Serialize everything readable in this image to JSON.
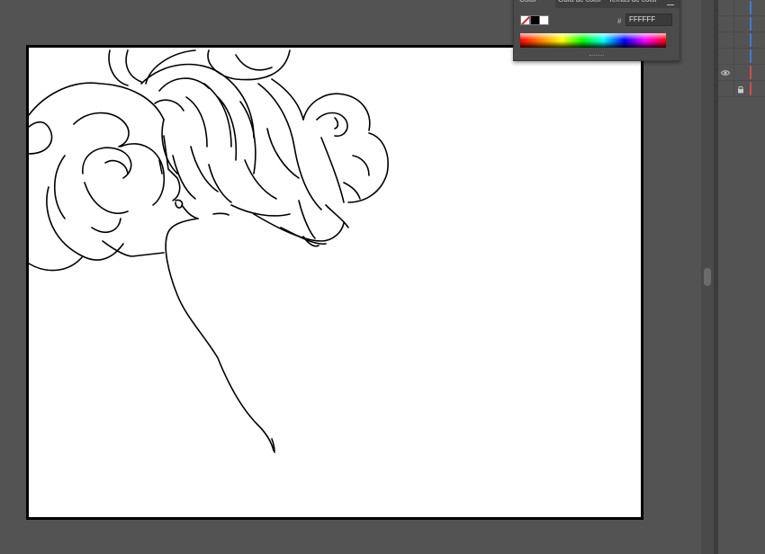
{
  "colors": {
    "workspace": "#535353",
    "artboard": "#ffffff",
    "artboard_border": "#000000",
    "layer_stripe_blue": "#3d7bd9",
    "layer_stripe_red": "#d84848"
  },
  "color_panel": {
    "tabs": [
      "Color",
      "Guía de color",
      "Temas de color"
    ],
    "hex_label": "#",
    "hex_value": "FFFFFF",
    "icons": [
      "fill-none-swatch",
      "black-swatch",
      "white-swatch",
      "panel-menu-icon"
    ]
  },
  "layers": {
    "icons": [
      "eye-icon",
      "lock-icon"
    ]
  },
  "canvas": {
    "content": "line-art"
  }
}
